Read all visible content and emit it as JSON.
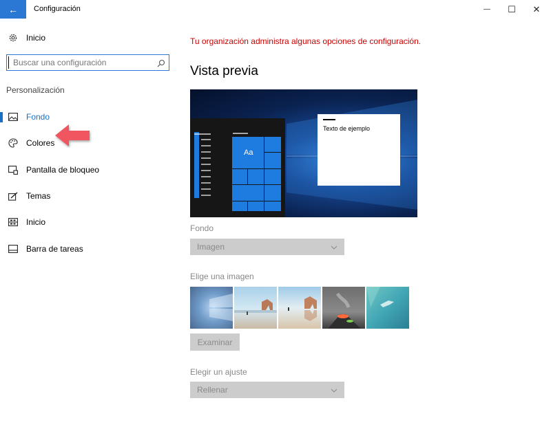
{
  "window": {
    "title": "Configuración",
    "back_glyph": "←",
    "minimize_glyph": "—",
    "maximize_glyph": "☐",
    "close_glyph": "✕",
    "accent_color": "#2b78d4"
  },
  "sidebar": {
    "home_label": "Inicio",
    "search_placeholder": "Buscar una configuración",
    "section_label": "Personalización",
    "items": [
      {
        "label": "Fondo",
        "icon": "picture-icon",
        "active": true
      },
      {
        "label": "Colores",
        "icon": "palette-icon",
        "active": false
      },
      {
        "label": "Pantalla de bloqueo",
        "icon": "lock-screen-icon",
        "active": false
      },
      {
        "label": "Temas",
        "icon": "theme-brush-icon",
        "active": false
      },
      {
        "label": "Inicio",
        "icon": "start-tiles-icon",
        "active": false
      },
      {
        "label": "Barra de tareas",
        "icon": "taskbar-icon",
        "active": false
      }
    ],
    "active_color": "#1a6fc4"
  },
  "main": {
    "org_message": "Tu organización administra algunas opciones de configuración.",
    "org_message_color": "#cc0000",
    "preview_heading": "Vista previa",
    "preview": {
      "tile_label": "Aa",
      "sample_text": "Texto de ejemplo"
    },
    "background_label": "Fondo",
    "background_value": "Imagen",
    "choose_image_label": "Elige una imagen",
    "thumbnails": [
      "windows-light-rays",
      "beach-rock-arch",
      "beach-rock-arch-reflection",
      "volcano-night",
      "underwater-swimmer"
    ],
    "browse_label": "Examinar",
    "fit_label": "Elegir un ajuste",
    "fit_value": "Rellenar"
  },
  "annotation": {
    "callout": "red-arrow-pointing-left",
    "color": "#f0575f"
  }
}
